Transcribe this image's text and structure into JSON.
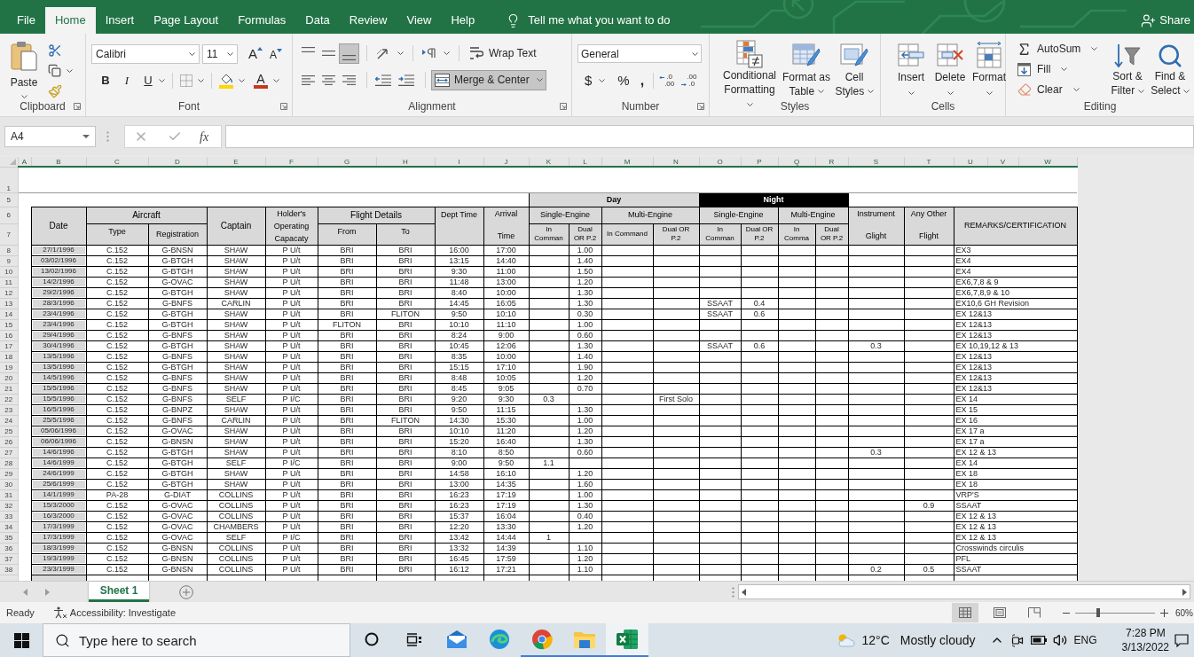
{
  "ribbon_tabs": [
    {
      "label": "File",
      "selected": false
    },
    {
      "label": "Home",
      "selected": true
    },
    {
      "label": "Insert",
      "selected": false
    },
    {
      "label": "Page Layout",
      "selected": false
    },
    {
      "label": "Formulas",
      "selected": false
    },
    {
      "label": "Data",
      "selected": false
    },
    {
      "label": "Review",
      "selected": false
    },
    {
      "label": "View",
      "selected": false
    },
    {
      "label": "Help",
      "selected": false
    }
  ],
  "tell_me": "Tell me what you want to do",
  "share": "Share",
  "clipboard": {
    "paste": "Paste",
    "label": "Clipboard"
  },
  "font": {
    "name": "Calibri",
    "size": "11",
    "grow": "A",
    "shrink": "A",
    "bold": "B",
    "italic": "I",
    "underline": "U",
    "color_letter": "A",
    "label": "Font"
  },
  "alignment": {
    "vertical": [
      {
        "kind": "top",
        "selected": false
      },
      {
        "kind": "middle",
        "selected": false
      },
      {
        "kind": "bottom",
        "selected": true
      }
    ],
    "horizontal": [
      {
        "kind": "left",
        "selected": false
      },
      {
        "kind": "center",
        "selected": false
      },
      {
        "kind": "right",
        "selected": false
      }
    ],
    "wrap_text": {
      "label": "Wrap Text",
      "selected": false
    },
    "merge_center": {
      "label": "Merge & Center",
      "selected": true
    },
    "label": "Alignment"
  },
  "number": {
    "format": "General",
    "currency": "$",
    "percent": "%",
    "comma": ",",
    "increase_decimal": [
      ".0",
      ".00"
    ],
    "decrease_decimal": [
      ".00",
      ".0"
    ],
    "label": "Number"
  },
  "styles": {
    "buttons": [
      {
        "kind": "conditional",
        "label": "Conditional Formatting"
      },
      {
        "kind": "table",
        "label": "Format as Table"
      },
      {
        "kind": "cell_styles",
        "label": "Cell Styles"
      }
    ],
    "label": "Styles"
  },
  "cells": {
    "buttons": [
      {
        "kind": "insert",
        "label": "Insert"
      },
      {
        "kind": "delete",
        "label": "Delete"
      },
      {
        "kind": "format",
        "label": "Format"
      }
    ],
    "label": "Cells"
  },
  "editing": {
    "small": [
      {
        "kind": "autosum",
        "label": "AutoSum"
      },
      {
        "kind": "fill",
        "label": "Fill"
      },
      {
        "kind": "clear",
        "label": "Clear"
      }
    ],
    "large": [
      {
        "kind": "sort",
        "label": "Sort & Filter"
      },
      {
        "kind": "find",
        "label": "Find & Select"
      }
    ],
    "label": "Editing"
  },
  "formula_bar": {
    "name_box": "A4",
    "function_label": "fx"
  },
  "sheet": {
    "columns": [
      "A",
      "B",
      "C",
      "D",
      "E",
      "F",
      "G",
      "H",
      "I",
      "J",
      "K",
      "L",
      "M",
      "N",
      "O",
      "P",
      "Q",
      "R",
      "S",
      "T",
      "U",
      "V",
      "W"
    ],
    "header_rows": [
      "1",
      "5",
      "6",
      "7"
    ],
    "bands": [
      {
        "kind": "day",
        "label": "Day"
      },
      {
        "kind": "night",
        "label": "Night"
      }
    ],
    "headers": {
      "date": "Date",
      "aircraft": {
        "label": "Aircraft",
        "sub": [
          "Type",
          "Registration"
        ]
      },
      "captain": "Captain",
      "capacity": "Holder's Operating Capacaty",
      "flight_details": {
        "label": "Flight Details",
        "sub": [
          "From",
          "To"
        ]
      },
      "dept_time": "Dept Time",
      "arrival": [
        "Arrival",
        "Time"
      ],
      "engine_groups": [
        {
          "label": "Single-Engine",
          "sub": [
            "In Comman",
            "Dual OR P.2"
          ]
        },
        {
          "label": "Multi-Engine",
          "sub": [
            "In Command",
            "Dual OR P.2"
          ]
        },
        {
          "label": "Single-Engine",
          "sub": [
            "In Comman",
            "Dual OR P.2"
          ]
        },
        {
          "label": "Multi-Engine",
          "sub": [
            "In Comma",
            "Dual OR P.2"
          ]
        }
      ],
      "instrument": [
        "Instrument",
        "Glight"
      ],
      "any_other": [
        "Any Other",
        "Flight"
      ],
      "remarks": "REMARKS/CERTIFICATION"
    },
    "rows": [
      {
        "row": "8",
        "date": "27/1/1996",
        "type": "C.152",
        "reg": "G-BNSN",
        "captain": "SHAW",
        "capacity": "P U/t",
        "from": "BRI",
        "to": "BRI",
        "dept": "16:00",
        "arr": "17:00",
        "d_se_dual": "1.00",
        "remarks": "EX3"
      },
      {
        "row": "9",
        "date": "03/02/1996",
        "type": "C.152",
        "reg": "G-BTGH",
        "captain": "SHAW",
        "capacity": "P U/t",
        "from": "BRI",
        "to": "BRI",
        "dept": "13:15",
        "arr": "14:40",
        "d_se_dual": "1.40",
        "remarks": "EX4"
      },
      {
        "row": "10",
        "date": "13/02/1996",
        "type": "C.152",
        "reg": "G-BTGH",
        "captain": "SHAW",
        "capacity": "P U/t",
        "from": "BRI",
        "to": "BRI",
        "dept": "9:30",
        "arr": "11:00",
        "d_se_dual": "1.50",
        "remarks": "EX4"
      },
      {
        "row": "11",
        "date": "14/2/1996",
        "type": "C.152",
        "reg": "G-OVAC",
        "captain": "SHAW",
        "capacity": "P U/t",
        "from": "BRI",
        "to": "BRI",
        "dept": "11:48",
        "arr": "13:00",
        "d_se_dual": "1.20",
        "remarks": "EX6,7,8 & 9"
      },
      {
        "row": "12",
        "date": "29/2/1996",
        "type": "C.152",
        "reg": "G-BTGH",
        "captain": "SHAW",
        "capacity": "P U/t",
        "from": "BRI",
        "to": "BRI",
        "dept": "8:40",
        "arr": "10:00",
        "d_se_dual": "1.30",
        "remarks": "EX6,7,8,9 & 10"
      },
      {
        "row": "13",
        "date": "28/3/1996",
        "type": "C.152",
        "reg": "G-BNFS",
        "captain": "CARLIN",
        "capacity": "P U/t",
        "from": "BRI",
        "to": "BRI",
        "dept": "14:45",
        "arr": "16:05",
        "d_se_dual": "1.30",
        "n_se_cmd": "SSAAT",
        "n_se_dual": "0.4",
        "remarks": "EX10,6 GH Revision"
      },
      {
        "row": "14",
        "date": "23/4/1996",
        "type": "C.152",
        "reg": "G-BTGH",
        "captain": "SHAW",
        "capacity": "P U/t",
        "from": "BRI",
        "to": "FLITON",
        "dept": "9:50",
        "arr": "10:10",
        "d_se_dual": "0.30",
        "n_se_cmd": "SSAAT",
        "n_se_dual": "0.6",
        "remarks": "EX 12&13"
      },
      {
        "row": "15",
        "date": "23/4/1996",
        "type": "C.152",
        "reg": "G-BTGH",
        "captain": "SHAW",
        "capacity": "P U/t",
        "from": "FLITON",
        "to": "BRI",
        "dept": "10:10",
        "arr": "11:10",
        "d_se_dual": "1.00",
        "remarks": "EX 12&13"
      },
      {
        "row": "16",
        "date": "29/4/1996",
        "type": "C.152",
        "reg": "G-BNFS",
        "captain": "SHAW",
        "capacity": "P U/t",
        "from": "BRI",
        "to": "BRI",
        "dept": "8:24",
        "arr": "9:00",
        "d_se_dual": "0.60",
        "remarks": "EX 12&13"
      },
      {
        "row": "17",
        "date": "30/4/1996",
        "type": "C.152",
        "reg": "G-BTGH",
        "captain": "SHAW",
        "capacity": "P U/t",
        "from": "BRI",
        "to": "BRI",
        "dept": "10:45",
        "arr": "12:06",
        "d_se_dual": "1.30",
        "n_se_cmd": "SSAAT",
        "n_se_dual": "0.6",
        "instrument": "0.3",
        "remarks": "EX 10,19,12 & 13"
      },
      {
        "row": "18",
        "date": "13/5/1996",
        "type": "C.152",
        "reg": "G-BNFS",
        "captain": "SHAW",
        "capacity": "P U/t",
        "from": "BRI",
        "to": "BRI",
        "dept": "8:35",
        "arr": "10:00",
        "d_se_dual": "1.40",
        "remarks": "EX 12&13"
      },
      {
        "row": "19",
        "date": "13/5/1996",
        "type": "C.152",
        "reg": "G-BTGH",
        "captain": "SHAW",
        "capacity": "P U/t",
        "from": "BRI",
        "to": "BRI",
        "dept": "15:15",
        "arr": "17:10",
        "d_se_dual": "1.90",
        "remarks": "EX 12&13"
      },
      {
        "row": "20",
        "date": "14/5/1996",
        "type": "C.152",
        "reg": "G-BNFS",
        "captain": "SHAW",
        "capacity": "P U/t",
        "from": "BRI",
        "to": "BRI",
        "dept": "8:48",
        "arr": "10:05",
        "d_se_dual": "1.20",
        "remarks": "EX 12&13"
      },
      {
        "row": "21",
        "date": "15/5/1996",
        "type": "C.152",
        "reg": "G-BNFS",
        "captain": "SHAW",
        "capacity": "P U/t",
        "from": "BRI",
        "to": "BRI",
        "dept": "8:45",
        "arr": "9:05",
        "d_se_dual": "0.70",
        "remarks": "EX 12&13"
      },
      {
        "row": "22",
        "date": "15/5/1996",
        "type": "C.152",
        "reg": "G-BNFS",
        "captain": "SELF",
        "capacity": "P I/C",
        "from": "BRI",
        "to": "BRI",
        "dept": "9:20",
        "arr": "9:30",
        "d_se_cmd": "0.3",
        "d_me_dual": "First Solo",
        "remarks": "EX 14"
      },
      {
        "row": "23",
        "date": "16/5/1996",
        "type": "C.152",
        "reg": "G-BNPZ",
        "captain": "SHAW",
        "capacity": "P U/t",
        "from": "BRI",
        "to": "BRI",
        "dept": "9:50",
        "arr": "11:15",
        "d_se_dual": "1.30",
        "remarks": "EX 15"
      },
      {
        "row": "24",
        "date": "25/5/1996",
        "type": "C.152",
        "reg": "G-BNFS",
        "captain": "CARLIN",
        "capacity": "P U/t",
        "from": "BRI",
        "to": "FLITON",
        "dept": "14:30",
        "arr": "15:30",
        "d_se_dual": "1.00",
        "remarks": "EX 16"
      },
      {
        "row": "25",
        "date": "05/06/1996",
        "type": "C.152",
        "reg": "G-OVAC",
        "captain": "SHAW",
        "capacity": "P U/t",
        "from": "BRI",
        "to": "BRI",
        "dept": "10:10",
        "arr": "11:20",
        "d_se_dual": "1.20",
        "remarks": "EX 17 a"
      },
      {
        "row": "26",
        "date": "06/06/1996",
        "type": "C.152",
        "reg": "G-BNSN",
        "captain": "SHAW",
        "capacity": "P U/t",
        "from": "BRI",
        "to": "BRI",
        "dept": "15:20",
        "arr": "16:40",
        "d_se_dual": "1.30",
        "remarks": "EX 17 a"
      },
      {
        "row": "27",
        "date": "14/6/1996",
        "type": "C.152",
        "reg": "G-BTGH",
        "captain": "SHAW",
        "capacity": "P U/t",
        "from": "BRI",
        "to": "BRI",
        "dept": "8:10",
        "arr": "8:50",
        "d_se_dual": "0.60",
        "instrument": "0.3",
        "remarks": "EX 12 & 13"
      },
      {
        "row": "28",
        "date": "14/6/1999",
        "type": "C.152",
        "reg": "G-BTGH",
        "captain": "SELF",
        "capacity": "P I/C",
        "from": "BRI",
        "to": "BRI",
        "dept": "9:00",
        "arr": "9:50",
        "d_se_cmd": "1.1",
        "remarks": "EX 14"
      },
      {
        "row": "29",
        "date": "24/6/1999",
        "type": "C.152",
        "reg": "G-BTGH",
        "captain": "SHAW",
        "capacity": "P U/t",
        "from": "BRI",
        "to": "BRI",
        "dept": "14:58",
        "arr": "16:10",
        "d_se_dual": "1.20",
        "remarks": "EX 18"
      },
      {
        "row": "30",
        "date": "25/6/1999",
        "type": "C.152",
        "reg": "G-BTGH",
        "captain": "SHAW",
        "capacity": "P U/t",
        "from": "BRI",
        "to": "BRI",
        "dept": "13:00",
        "arr": "14:35",
        "d_se_dual": "1.60",
        "remarks": "EX 18"
      },
      {
        "row": "31",
        "date": "14/1/1999",
        "type": "PA-28",
        "reg": "G-DIAT",
        "captain": "COLLINS",
        "capacity": "P U/t",
        "from": "BRI",
        "to": "BRI",
        "dept": "16:23",
        "arr": "17:19",
        "d_se_dual": "1.00",
        "remarks": "VRP'S"
      },
      {
        "row": "32",
        "date": "15/3/2000",
        "type": "C.152",
        "reg": "G-OVAC",
        "captain": "COLLINS",
        "capacity": "P U/t",
        "from": "BRI",
        "to": "BRI",
        "dept": "16:23",
        "arr": "17:19",
        "d_se_dual": "1.30",
        "other": "0.9",
        "remarks": "SSAAT"
      },
      {
        "row": "33",
        "date": "16/3/2000",
        "type": "C.152",
        "reg": "G-OVAC",
        "captain": "COLLINS",
        "capacity": "P U/t",
        "from": "BRI",
        "to": "BRI",
        "dept": "15:37",
        "arr": "16:04",
        "d_se_dual": "0.40",
        "remarks": "EX 12 & 13"
      },
      {
        "row": "34",
        "date": "17/3/1999",
        "type": "C.152",
        "reg": "G-OVAC",
        "captain": "CHAMBERS",
        "capacity": "P U/t",
        "from": "BRI",
        "to": "BRI",
        "dept": "12:20",
        "arr": "13:30",
        "d_se_dual": "1.20",
        "remarks": "EX 12 & 13"
      },
      {
        "row": "35",
        "date": "17/3/1999",
        "type": "C.152",
        "reg": "G-OVAC",
        "captain": "SELF",
        "capacity": "P I/C",
        "from": "BRI",
        "to": "BRI",
        "dept": "13:42",
        "arr": "14:44",
        "d_se_cmd": "1",
        "remarks": "EX 12 & 13"
      },
      {
        "row": "36",
        "date": "18/3/1999",
        "type": "C.152",
        "reg": "G-BNSN",
        "captain": "COLLINS",
        "capacity": "P U/t",
        "from": "BRI",
        "to": "BRI",
        "dept": "13:32",
        "arr": "14:39",
        "d_se_dual": "1.10",
        "remarks": "Crosswinds circulis"
      },
      {
        "row": "37",
        "date": "19/3/1999",
        "type": "C.152",
        "reg": "G-BNSN",
        "captain": "COLLINS",
        "capacity": "P U/t",
        "from": "BRI",
        "to": "BRI",
        "dept": "16:45",
        "arr": "17:59",
        "d_se_dual": "1.20",
        "remarks": "PFL"
      },
      {
        "row": "38",
        "date": "23/3/1999",
        "type": "C.152",
        "reg": "G-BNSN",
        "captain": "COLLINS",
        "capacity": "P U/t",
        "from": "BRI",
        "to": "BRI",
        "dept": "16:12",
        "arr": "17:21",
        "d_se_dual": "1.10",
        "instrument": "0.2",
        "other": "0.5",
        "remarks": "SSAAT"
      }
    ]
  },
  "sheet_tabs": [
    {
      "label": "Sheet 1",
      "selected": true
    }
  ],
  "status_bar": {
    "ready": "Ready",
    "accessibility": "Accessibility: Investigate",
    "views": [
      {
        "kind": "normal",
        "selected": true
      },
      {
        "kind": "page_layout",
        "selected": false
      },
      {
        "kind": "page_break",
        "selected": false
      }
    ],
    "zoom": {
      "level": 0.29,
      "reading": "60%"
    }
  },
  "taskbar": {
    "search": {
      "placeholder": "Type here to search"
    },
    "apps": [
      {
        "kind": "cortana",
        "running": false,
        "selected": false
      },
      {
        "kind": "task_view",
        "running": false,
        "selected": false
      },
      {
        "kind": "mail",
        "running": false,
        "selected": false
      },
      {
        "kind": "edge",
        "running": false,
        "selected": false
      },
      {
        "kind": "chrome",
        "running": true,
        "selected": false
      },
      {
        "kind": "explorer",
        "running": true,
        "selected": false
      },
      {
        "kind": "excel",
        "running": true,
        "selected": true
      }
    ],
    "weather": {
      "temperature": "12°C",
      "condition": "Mostly cloudy"
    },
    "language": "ENG",
    "time": "7:28 PM",
    "date": "3/13/2022"
  }
}
